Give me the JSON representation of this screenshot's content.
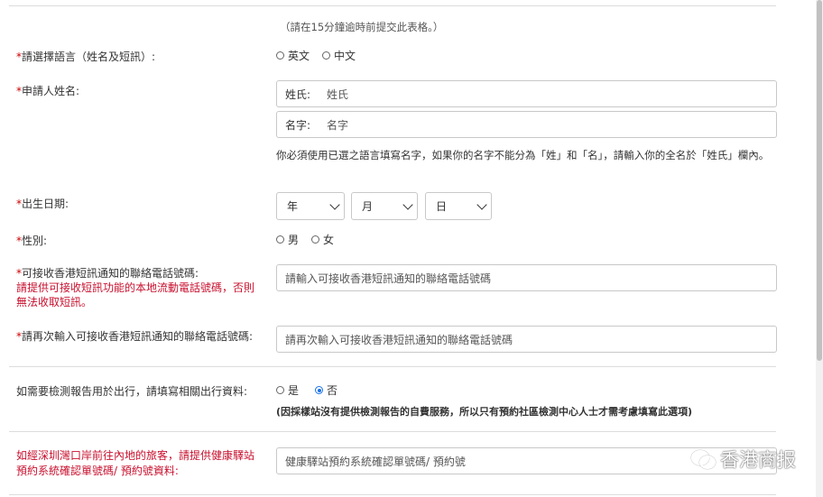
{
  "hint_submit": "（請在15分鐘逾時前提交此表格。）",
  "language": {
    "label": "請選擇語言（姓名及短訊）:",
    "options": [
      "英文",
      "中文"
    ]
  },
  "name": {
    "label": "申請人姓名:",
    "surname_prefix": "姓氏:",
    "surname_placeholder": "姓氏",
    "given_prefix": "名字:",
    "given_placeholder": "名字",
    "warning": "你必須使用已選之語言填寫名字，如果你的名字不能分為「姓」和「名」，請輸入你的全名於「姓氏」欄內。"
  },
  "dob": {
    "label": "出生日期:",
    "year": "年",
    "month": "月",
    "day": "日"
  },
  "gender": {
    "label": "性別:",
    "options": [
      "男",
      "女"
    ]
  },
  "phone": {
    "label": "可接收香港短訊通知的聯絡電話號碼:",
    "sublabel": "請提供可接收短訊功能的本地流動電話號碼，否則無法收取短訊。",
    "placeholder": "請輸入可接收香港短訊通知的聯絡電話號碼"
  },
  "phone_confirm": {
    "label": "請再次輸入可接收香港短訊通知的聯絡電話號碼:",
    "placeholder": "請再次輸入可接收香港短訊通知的聯絡電話號碼"
  },
  "travel": {
    "label": "如需要檢測報告用於出行，請填寫相關出行資料:",
    "options": [
      "是",
      "否"
    ],
    "selected": "否",
    "note": "(因採樣站沒有提供檢測報告的自費服務，所以只有預約社區檢測中心人士才需考慮填寫此選項)"
  },
  "health_station": {
    "label": "如經深圳灣口岸前往內地的旅客，請提供健康驛站預約系統確認單號碼/ 預約號資料:",
    "placeholder": "健康驛站預約系統確認單號碼/ 預約號"
  },
  "watermark": "香港商报",
  "required_mark": "*"
}
